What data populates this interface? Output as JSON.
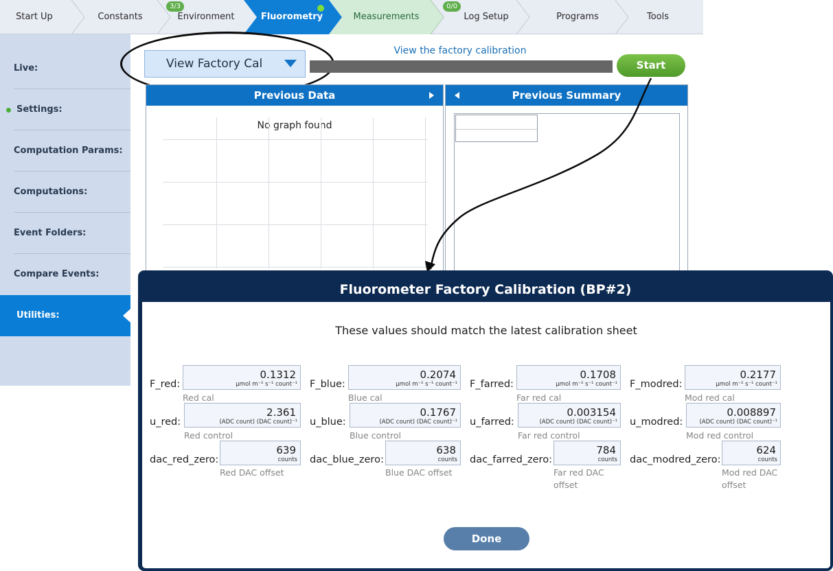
{
  "tabs": [
    {
      "label": "Start Up"
    },
    {
      "label": "Constants"
    },
    {
      "label": "Environment",
      "badge": "3/3"
    },
    {
      "label": "Fluorometry",
      "state": "active"
    },
    {
      "label": "Measurements",
      "badge": "0/0",
      "state": "highlighted"
    },
    {
      "label": "Log Setup"
    },
    {
      "label": "Programs"
    },
    {
      "label": "Tools"
    }
  ],
  "sidebar": {
    "items": [
      {
        "label": "Live:"
      },
      {
        "label": "Settings:",
        "status_dot": "green"
      },
      {
        "label": "Computation Params:"
      },
      {
        "label": "Computations:"
      },
      {
        "label": "Event Folders:"
      },
      {
        "label": "Compare Events:"
      },
      {
        "label": "Utilities:",
        "state": "active"
      }
    ]
  },
  "toolbar": {
    "select_value": "View Factory Cal",
    "hint": "View the factory calibration",
    "start_label": "Start",
    "start_color": "#5fae38"
  },
  "panels": {
    "previous_data_title": "Previous Data",
    "no_graph": "No graph found",
    "previous_summary_title": "Previous Summary"
  },
  "modal": {
    "title": "Fluorometer Factory Calibration (BP#2)",
    "subtitle": "These values should match the latest calibration sheet",
    "done_label": "Done",
    "header_color": "#0d2a52",
    "fields": [
      {
        "label": "F_red:",
        "value": "0.1312",
        "unit": "μmol m⁻² s⁻¹ count⁻¹",
        "caption": "Red cal"
      },
      {
        "label": "F_blue:",
        "value": "0.2074",
        "unit": "μmol m⁻² s⁻¹ count⁻¹",
        "caption": "Blue cal"
      },
      {
        "label": "F_farred:",
        "value": "0.1708",
        "unit": "μmol m⁻² s⁻¹ count⁻¹",
        "caption": "Far red cal"
      },
      {
        "label": "F_modred:",
        "value": "0.2177",
        "unit": "μmol m⁻² s⁻¹ count⁻¹",
        "caption": "Mod red cal"
      },
      {
        "label": "u_red:",
        "value": "2.361",
        "unit": "(ADC count) (DAC count)⁻¹",
        "caption": "Red control"
      },
      {
        "label": "u_blue:",
        "value": "0.1767",
        "unit": "(ADC count) (DAC count)⁻¹",
        "caption": "Blue control"
      },
      {
        "label": "u_farred:",
        "value": "0.003154",
        "unit": "(ADC count) (DAC count)⁻¹",
        "caption": "Far red control"
      },
      {
        "label": "u_modred:",
        "value": "0.008897",
        "unit": "(ADC count) (DAC count)⁻¹",
        "caption": "Mod red control"
      },
      {
        "label": "dac_red_zero:",
        "value": "639",
        "unit": "counts",
        "caption": "Red DAC offset"
      },
      {
        "label": "dac_blue_zero:",
        "value": "638",
        "unit": "counts",
        "caption": "Blue DAC offset"
      },
      {
        "label": "dac_farred_zero:",
        "value": "784",
        "unit": "counts",
        "caption": "Far red DAC offset"
      },
      {
        "label": "dac_modred_zero:",
        "value": "624",
        "unit": "counts",
        "caption": "Mod red DAC offset"
      }
    ]
  }
}
